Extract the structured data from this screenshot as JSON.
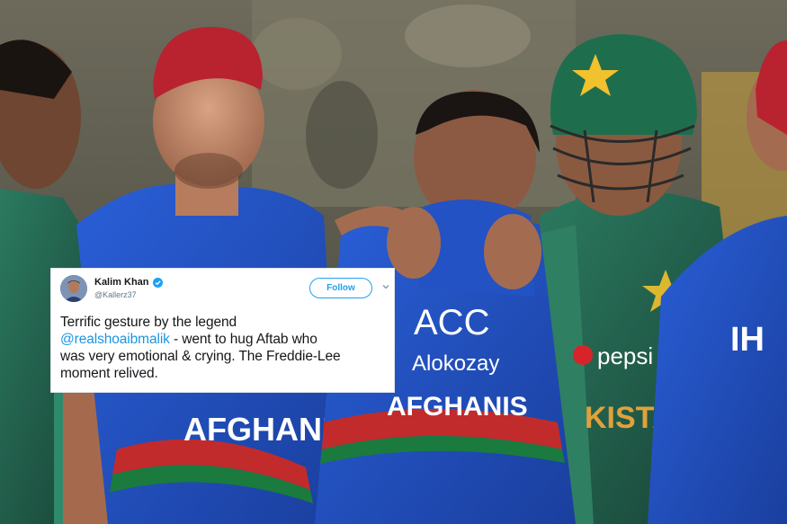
{
  "tweet": {
    "display_name": "Kalim Khan",
    "handle": "@Kallerz37",
    "follow_label": "Follow",
    "text_line1": "Terrific gesture by the legend",
    "mention": "@realshoaibmalik",
    "text_after_mention": " - went to hug Aftab who",
    "text_line3": "was very emotional & crying. The Freddie-Lee",
    "text_line4": "moment relived."
  },
  "photo": {
    "jersey_text_center": "AFGHANIS",
    "jersey_sponsor_center": "ACC",
    "jersey_sponsor_sub": "Alokozay",
    "jersey_text_left": "AFGHANI",
    "jersey_text_pak": "KISTA",
    "jersey_sponsor_pak": "pepsi",
    "jersey_text_right": "IH"
  },
  "colors": {
    "afghan_blue": "#1d4fc4",
    "pak_green": "#1f5c49",
    "twitter_blue": "#1da1f2",
    "helmet_star": "#f2c12e"
  }
}
